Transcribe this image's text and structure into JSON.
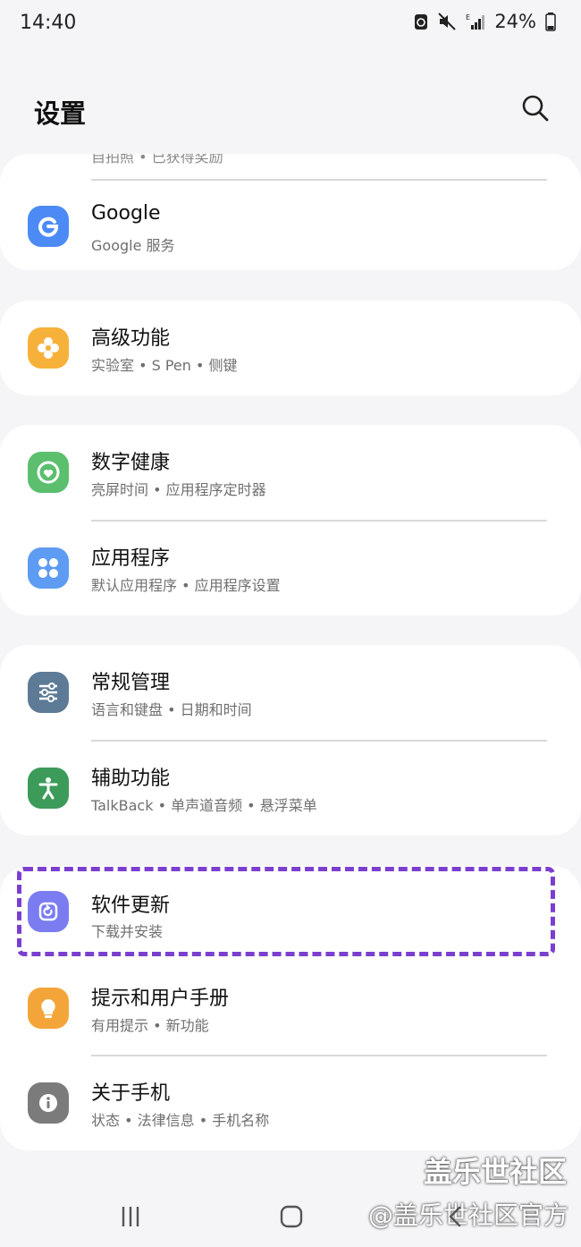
{
  "status_bar": {
    "time": "14:40",
    "battery_percent": "24%",
    "icons": [
      "sync-icon",
      "mute-icon",
      "signal-icon",
      "battery-icon"
    ],
    "network_label": "E"
  },
  "header": {
    "title": "设置",
    "search_icon": "search-icon"
  },
  "partial_row": {
    "subtitle": "自拍照 • 已获得奖励"
  },
  "items": [
    {
      "title": "Google",
      "subtitle": "Google 服务",
      "icon": "google-icon",
      "color": "#4c8bf5"
    },
    {
      "title": "高级功能",
      "subtitle": "实验室 • S Pen • 侧键",
      "icon": "advanced-features-icon",
      "color": "#f6b13a"
    },
    {
      "title": "数字健康",
      "subtitle": "亮屏时间 • 应用程序定时器",
      "icon": "digital-wellbeing-icon",
      "color": "#5bbf6e"
    },
    {
      "title": "应用程序",
      "subtitle": "默认应用程序 • 应用程序设置",
      "icon": "apps-icon",
      "color": "#5e9bf3"
    },
    {
      "title": "常规管理",
      "subtitle": "语言和键盘 • 日期和时间",
      "icon": "general-management-icon",
      "color": "#5d7b97"
    },
    {
      "title": "辅助功能",
      "subtitle": "TalkBack • 单声道音频 • 悬浮菜单",
      "icon": "accessibility-icon",
      "color": "#3d9b5a"
    },
    {
      "title": "软件更新",
      "subtitle": "下载并安装",
      "icon": "software-update-icon",
      "color": "#7a7cf0"
    },
    {
      "title": "提示和用户手册",
      "subtitle": "有用提示 • 新功能",
      "icon": "tips-icon",
      "color": "#f4a53a"
    },
    {
      "title": "关于手机",
      "subtitle": "状态 • 法律信息 • 手机名称",
      "icon": "about-phone-icon",
      "color": "#7b7b7b"
    }
  ],
  "watermark": {
    "line1": "盖乐世社区",
    "line2": "@盖乐世社区官方"
  },
  "nav_bar": {
    "recent": "recent-apps-icon",
    "home": "home-icon",
    "back": "back-icon"
  }
}
